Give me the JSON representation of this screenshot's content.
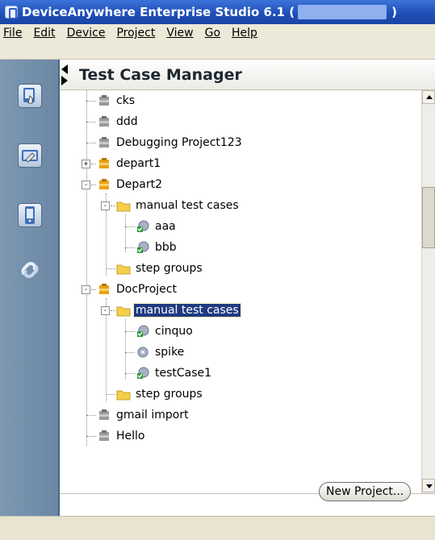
{
  "window": {
    "title_prefix": "DeviceAnywhere Enterprise Studio 6.1 (",
    "title_suffix": ")"
  },
  "menubar": {
    "items": [
      "File",
      "Edit",
      "Device",
      "Project",
      "View",
      "Go",
      "Help"
    ]
  },
  "leftbar": {
    "tools": [
      "test-case-tool-icon",
      "settings-tool-icon",
      "device-tool-icon",
      "link-tool-icon"
    ]
  },
  "panel": {
    "title": "Test Case Manager",
    "new_project_label": "New Project..."
  },
  "tree": {
    "nodes": [
      {
        "label": "cks",
        "icon": "project-closed"
      },
      {
        "label": "ddd",
        "icon": "project-closed"
      },
      {
        "label": "Debugging Project123",
        "icon": "project-closed"
      },
      {
        "label": "depart1",
        "icon": "project-open",
        "expander": "+"
      },
      {
        "label": "Depart2",
        "icon": "project-open",
        "expander": "-"
      },
      {
        "label": "manual test cases",
        "icon": "folder",
        "expander": "-"
      },
      {
        "label": "aaa",
        "icon": "test-case-checked"
      },
      {
        "label": "bbb",
        "icon": "test-case-checked"
      },
      {
        "label": "step groups",
        "icon": "folder"
      },
      {
        "label": "DocProject",
        "icon": "project-open",
        "expander": "-"
      },
      {
        "label": "manual test cases",
        "icon": "folder",
        "expander": "-",
        "selected": true
      },
      {
        "label": "cinquo",
        "icon": "test-case-checked"
      },
      {
        "label": "spike",
        "icon": "test-case"
      },
      {
        "label": "testCase1",
        "icon": "test-case-checked"
      },
      {
        "label": "step groups",
        "icon": "folder"
      },
      {
        "label": "gmail import",
        "icon": "project-closed"
      },
      {
        "label": "Hello",
        "icon": "project-closed"
      }
    ]
  },
  "colors": {
    "titlebar": "#2a5cc6",
    "selection": "#1f3a80",
    "leftbar": "#7490ab"
  }
}
